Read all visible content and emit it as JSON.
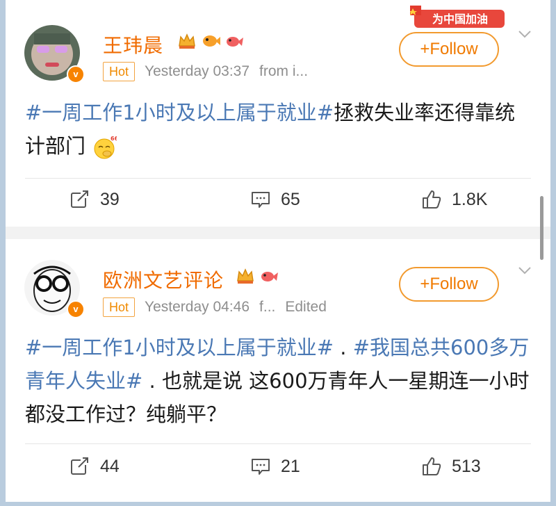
{
  "posts": [
    {
      "username": "王玮晨",
      "hot_label": "Hot",
      "time": "Yesterday 03:37",
      "source": "from i...",
      "edited": "",
      "follow_label": "+Follow",
      "promo_text": "为中国加油",
      "content_tag": "#一周工作1小时及以上属于就业#",
      "content_text": "拯救失业率还得靠统计部门",
      "reposts": "39",
      "comments": "65",
      "likes": "1.8K"
    },
    {
      "username": "欧洲文艺评论",
      "hot_label": "Hot",
      "time": "Yesterday 04:46",
      "source": "f...",
      "edited": "Edited",
      "follow_label": "+Follow",
      "content_tag": "#一周工作1小时及以上属于就业#",
      "content_sep": " . ",
      "content_tag2": "#我国总共600多万青年人失业#",
      "content_text": " . 也就是说 这600万青年人一星期连一小时都没工作过？纯躺平？",
      "reposts": "44",
      "comments": "21",
      "likes": "513"
    }
  ],
  "colors": {
    "username": "#f06b00",
    "hashtag": "#4a78b4",
    "follow_border": "#f29a2e",
    "frame": "#b9ccde"
  },
  "icons": [
    "repost-icon",
    "comment-icon",
    "like-icon",
    "chevron-down-icon",
    "verified-badge-icon",
    "crown-badge-icon",
    "fish-badge-icon"
  ]
}
